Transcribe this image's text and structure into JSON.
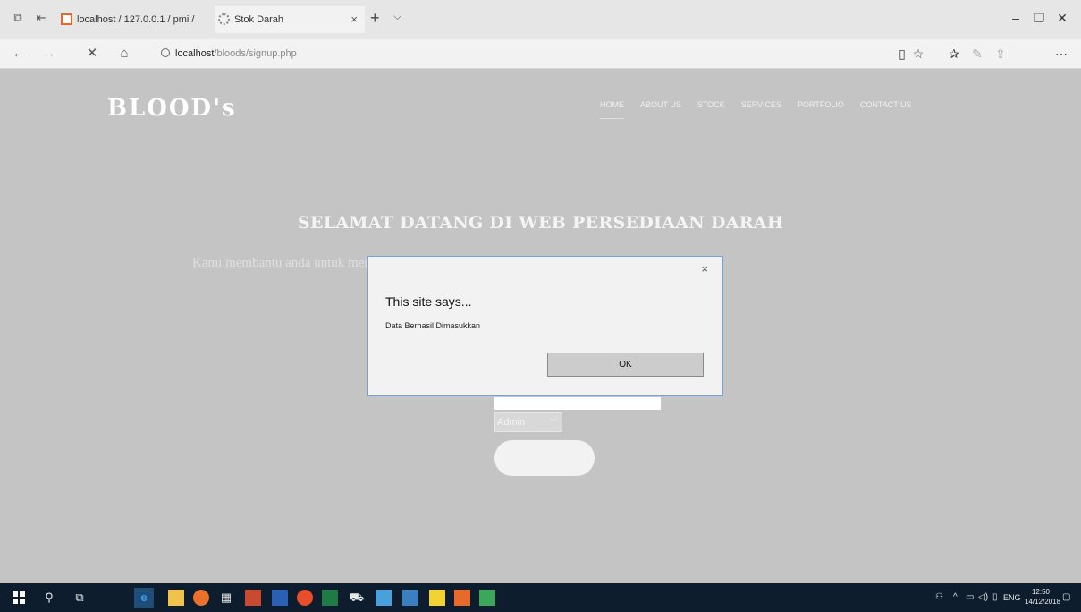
{
  "browser": {
    "tabs": [
      {
        "label": "localhost / 127.0.0.1 / pmi /"
      },
      {
        "label": "Stok Darah"
      }
    ],
    "address": {
      "host": "localhost",
      "path": "/bloods/signup.php"
    },
    "new_tab_glyph": "+",
    "tab_list_glyph": "⌵"
  },
  "site": {
    "logo": "BLOOD's",
    "nav": [
      "HOME",
      "ABOUT US",
      "STOCK",
      "SERVICES",
      "PORTFOLIO",
      "CONTACT US"
    ],
    "hero_title": "SELAMAT DATANG DI WEB PERSEDIAAN DARAH",
    "hero_subtitle": "Kami membantu anda untuk mengetahui informasi tentang persediaan stok darah,",
    "form": {
      "role_select_value": "Admin"
    }
  },
  "dialog": {
    "title": "This site says...",
    "message": "Data Berhasil Dimasukkan",
    "ok_label": "OK",
    "close_glyph": "×"
  },
  "taskbar": {
    "language": "ENG",
    "time": "12:50",
    "date": "14/12/2018"
  },
  "colors": {
    "page_bg": "#c4c4c4",
    "taskbar_bg": "#0d1d2e",
    "dialog_border": "#6fa5d8",
    "tab_favicon": "#e8652d"
  }
}
